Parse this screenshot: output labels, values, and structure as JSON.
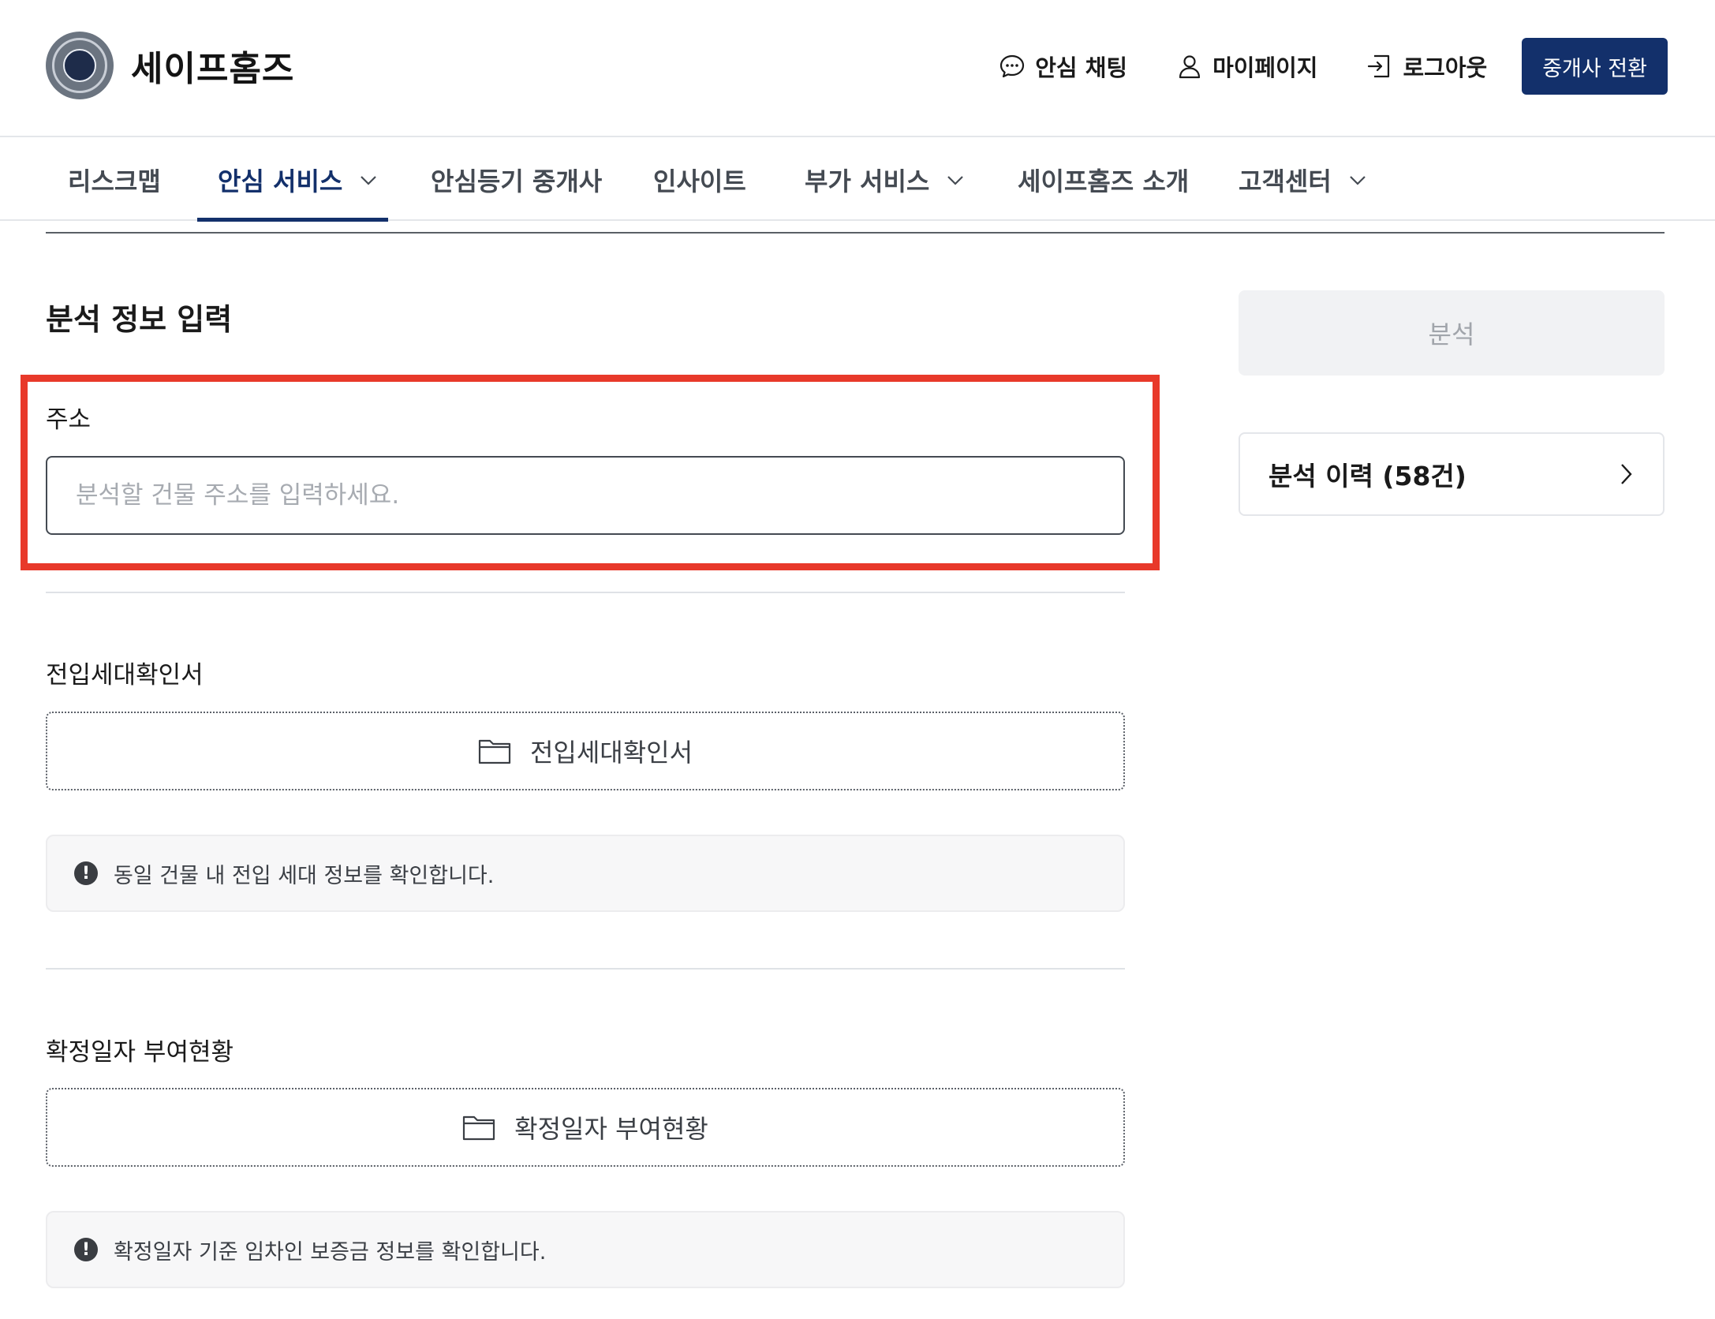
{
  "brand": {
    "name": "세이프홈즈",
    "logo_icon": "seal-logo-icon"
  },
  "header": {
    "chat_label": "안심 채팅",
    "mypage_label": "마이페이지",
    "logout_label": "로그아웃",
    "switch_label": "중개사 전환",
    "accent_color": "#13306b"
  },
  "nav": {
    "items": [
      {
        "label": "리스크맵",
        "has_dropdown": false
      },
      {
        "label": "안심 서비스",
        "has_dropdown": true,
        "active": true
      },
      {
        "label": "안심등기 중개사",
        "has_dropdown": false
      },
      {
        "label": "인사이트",
        "has_dropdown": false
      },
      {
        "label": "부가 서비스",
        "has_dropdown": true
      },
      {
        "label": "세이프홈즈 소개",
        "has_dropdown": false
      },
      {
        "label": "고객센터",
        "has_dropdown": true
      }
    ]
  },
  "form": {
    "title": "분석 정보 입력",
    "address": {
      "label": "주소",
      "placeholder": "분석할 건물 주소를 입력하세요.",
      "value": ""
    },
    "household": {
      "label": "전입세대확인서",
      "upload_label": "전입세대확인서",
      "info": "동일 건물 내 전입 세대 정보를 확인합니다."
    },
    "fixed_date": {
      "label": "확정일자 부여현황",
      "upload_label": "확정일자 부여현황",
      "info": "확정일자 기준 임차인 보증금 정보를 확인합니다."
    },
    "highlight_color": "#e8392a"
  },
  "side": {
    "analyze_label": "분석",
    "history_label": "분석 이력 (58건)"
  }
}
